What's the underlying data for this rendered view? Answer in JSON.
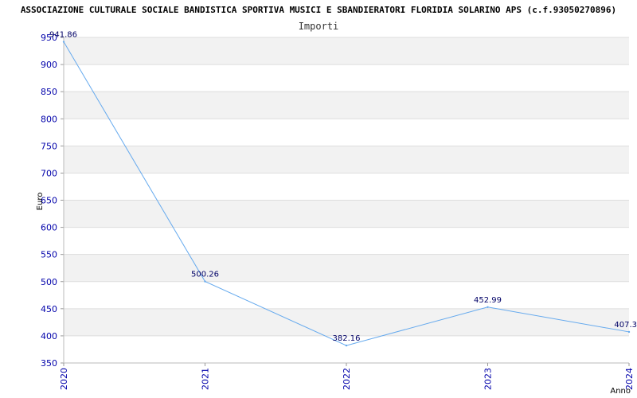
{
  "chart_data": {
    "type": "line",
    "title": "ASSOCIAZIONE CULTURALE SOCIALE BANDISTICA SPORTIVA MUSICI E SBANDIERATORI FLORIDIA SOLARINO APS (c.f.93050270896)",
    "subtitle": "Importi",
    "xlabel": "Anno",
    "ylabel": "Euro",
    "categories": [
      "2020",
      "2021",
      "2022",
      "2023",
      "2024"
    ],
    "values": [
      941.86,
      500.26,
      382.16,
      452.99,
      407.3
    ],
    "value_labels": [
      "941.86",
      "500.26",
      "382.16",
      "452.99",
      "407.3"
    ],
    "yticks": [
      350,
      400,
      450,
      500,
      550,
      600,
      650,
      700,
      750,
      800,
      850,
      900,
      950
    ],
    "ylim": [
      350,
      950
    ],
    "grid": true,
    "line_color": "#66aaee",
    "band_color": "#f2f2f2",
    "tick_color": "#0000aa"
  }
}
